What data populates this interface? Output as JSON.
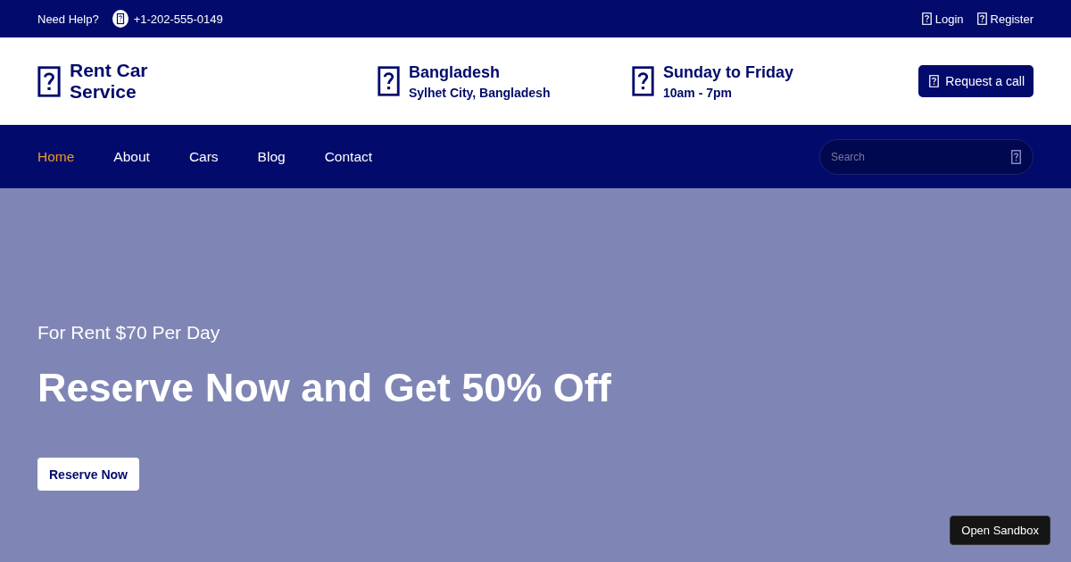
{
  "top_bar": {
    "help_label": "Need Help?",
    "phone": "+1-202-555-0149",
    "links": [
      {
        "label": "Login"
      },
      {
        "label": "Register"
      }
    ]
  },
  "header": {
    "brand": "Rent Car Service",
    "info": [
      {
        "title": "Bangladesh",
        "subtitle": "Sylhet City, Bangladesh"
      },
      {
        "title": "Sunday to Friday",
        "subtitle": "10am - 7pm"
      }
    ],
    "call_button": "Request a call"
  },
  "nav": {
    "items": [
      {
        "label": "Home",
        "selected": true
      },
      {
        "label": "About",
        "selected": false
      },
      {
        "label": "Cars",
        "selected": false
      },
      {
        "label": "Blog",
        "selected": false
      },
      {
        "label": "Contact",
        "selected": false
      }
    ],
    "search": {
      "placeholder": "Search"
    }
  },
  "hero": {
    "kicker": "For Rent $70 Per Day",
    "headline": "Reserve Now and Get 50% Off",
    "button": "Reserve Now"
  },
  "sandbox_button": "Open Sandbox"
}
